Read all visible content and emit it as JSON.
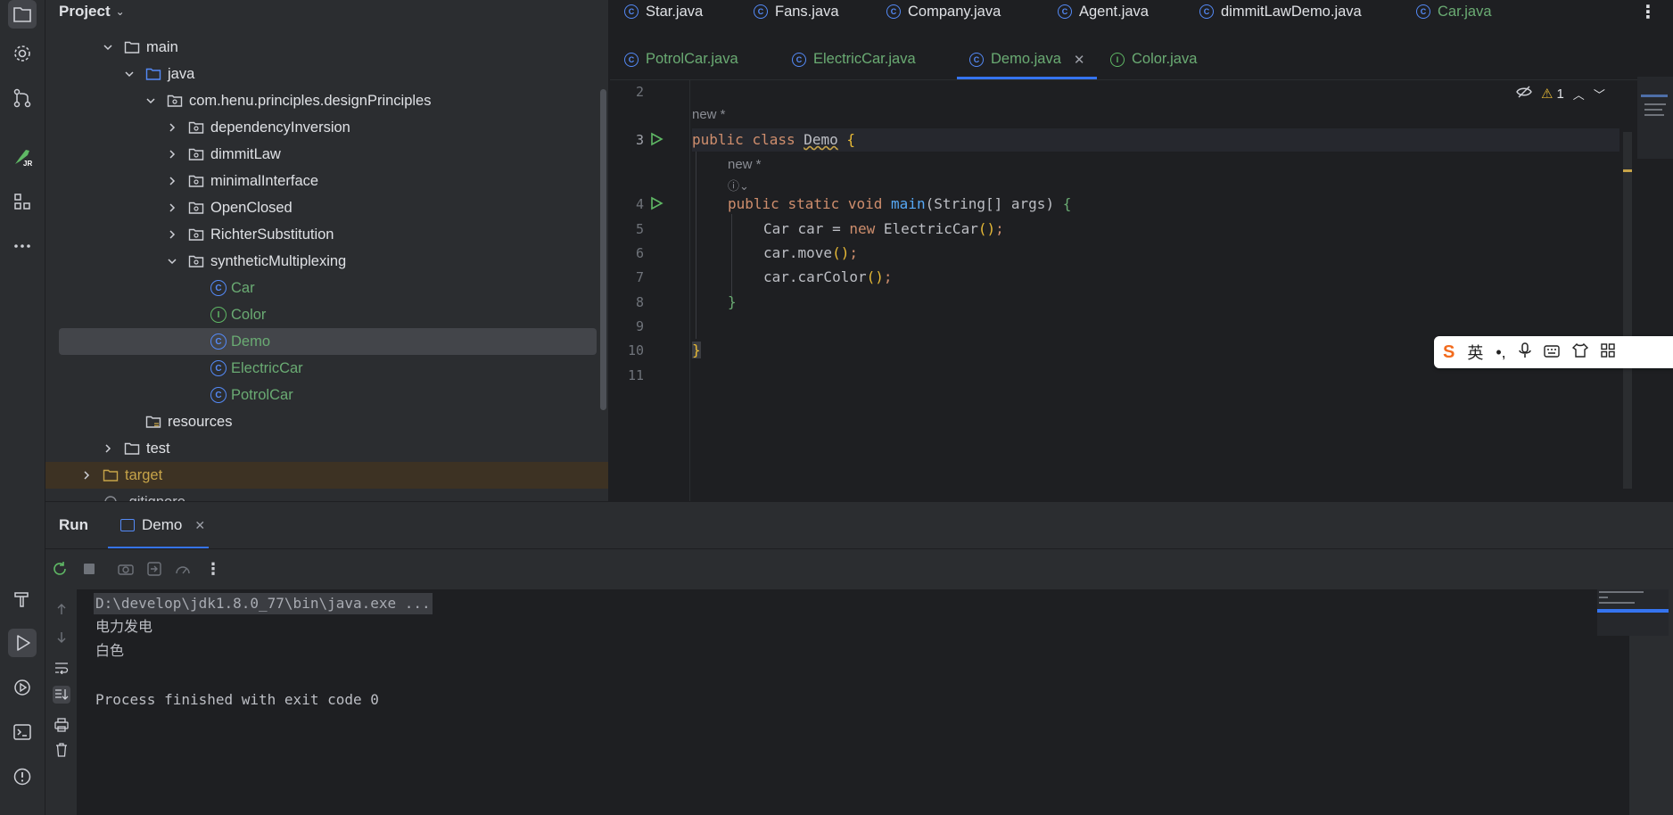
{
  "project_pane": {
    "title": "Project",
    "tree": [
      {
        "label": "main",
        "kind": "folder",
        "expanded": true
      },
      {
        "label": "java",
        "kind": "source-folder",
        "expanded": true
      },
      {
        "label": "com.henu.principles.designPrinciples",
        "kind": "package",
        "expanded": true
      },
      {
        "label": "dependencyInversion",
        "kind": "package",
        "expanded": false
      },
      {
        "label": "dimmitLaw",
        "kind": "package",
        "expanded": false
      },
      {
        "label": "minimalInterface",
        "kind": "package",
        "expanded": false
      },
      {
        "label": "OpenClosed",
        "kind": "package",
        "expanded": false
      },
      {
        "label": "RichterSubstitution",
        "kind": "package",
        "expanded": false
      },
      {
        "label": "syntheticMultiplexing",
        "kind": "package",
        "expanded": true
      },
      {
        "label": "Car",
        "kind": "class"
      },
      {
        "label": "Color",
        "kind": "interface"
      },
      {
        "label": "Demo",
        "kind": "class",
        "selected": true
      },
      {
        "label": "ElectricCar",
        "kind": "class"
      },
      {
        "label": "PotrolCar",
        "kind": "class"
      },
      {
        "label": "resources",
        "kind": "resources-folder"
      },
      {
        "label": "test",
        "kind": "folder",
        "expanded": false
      },
      {
        "label": "target",
        "kind": "excluded-folder",
        "expanded": false
      },
      {
        "label": ".gitignore",
        "kind": "file"
      }
    ]
  },
  "editor": {
    "tabs_row1": [
      "Star.java",
      "Fans.java",
      "Company.java",
      "Agent.java",
      "dimmitLawDemo.java",
      "Car.java"
    ],
    "tabs_row2": [
      {
        "label": "PotrolCar.java",
        "icon": "class"
      },
      {
        "label": "ElectricCar.java",
        "icon": "class"
      },
      {
        "label": "Demo.java",
        "icon": "class",
        "active": true
      },
      {
        "label": "Color.java",
        "icon": "interface"
      }
    ],
    "line_numbers": [
      "2",
      "3",
      "4",
      "5",
      "6",
      "7",
      "8",
      "9",
      "10",
      "11"
    ],
    "hints": {
      "new1": "new *",
      "new2": "new *"
    },
    "warnings_count": "1",
    "code": {
      "l3": {
        "kw1": "public",
        "kw2": "class",
        "name": "Demo",
        "brace": "{"
      },
      "l4": {
        "kw1": "public",
        "kw2": "static",
        "kw3": "void",
        "fn": "main",
        "params": "(String[] args) ",
        "brace": "{"
      },
      "l5": {
        "pre": "Car car = ",
        "kw": "new",
        "post": " ElectricCar",
        "paren": "()",
        "semi": ";"
      },
      "l6": {
        "pre": "car.move",
        "paren": "()",
        "semi": ";"
      },
      "l7": {
        "pre": "car.carColor",
        "paren": "()",
        "semi": ";"
      },
      "l8": {
        "brace": "}"
      },
      "l10": {
        "brace": "}"
      }
    }
  },
  "ime_bar": {
    "lang": "英"
  },
  "run_panel": {
    "title": "Run",
    "tab": "Demo",
    "console": [
      "D:\\develop\\jdk1.8.0_77\\bin\\java.exe ...",
      "电力发电",
      "白色",
      "",
      "Process finished with exit code 0"
    ]
  },
  "colors": {
    "accent": "#3574f0",
    "keyword": "#cf8e6d",
    "function": "#56a8f5",
    "class_icon": "#548af7",
    "interface_icon": "#5fb865"
  }
}
